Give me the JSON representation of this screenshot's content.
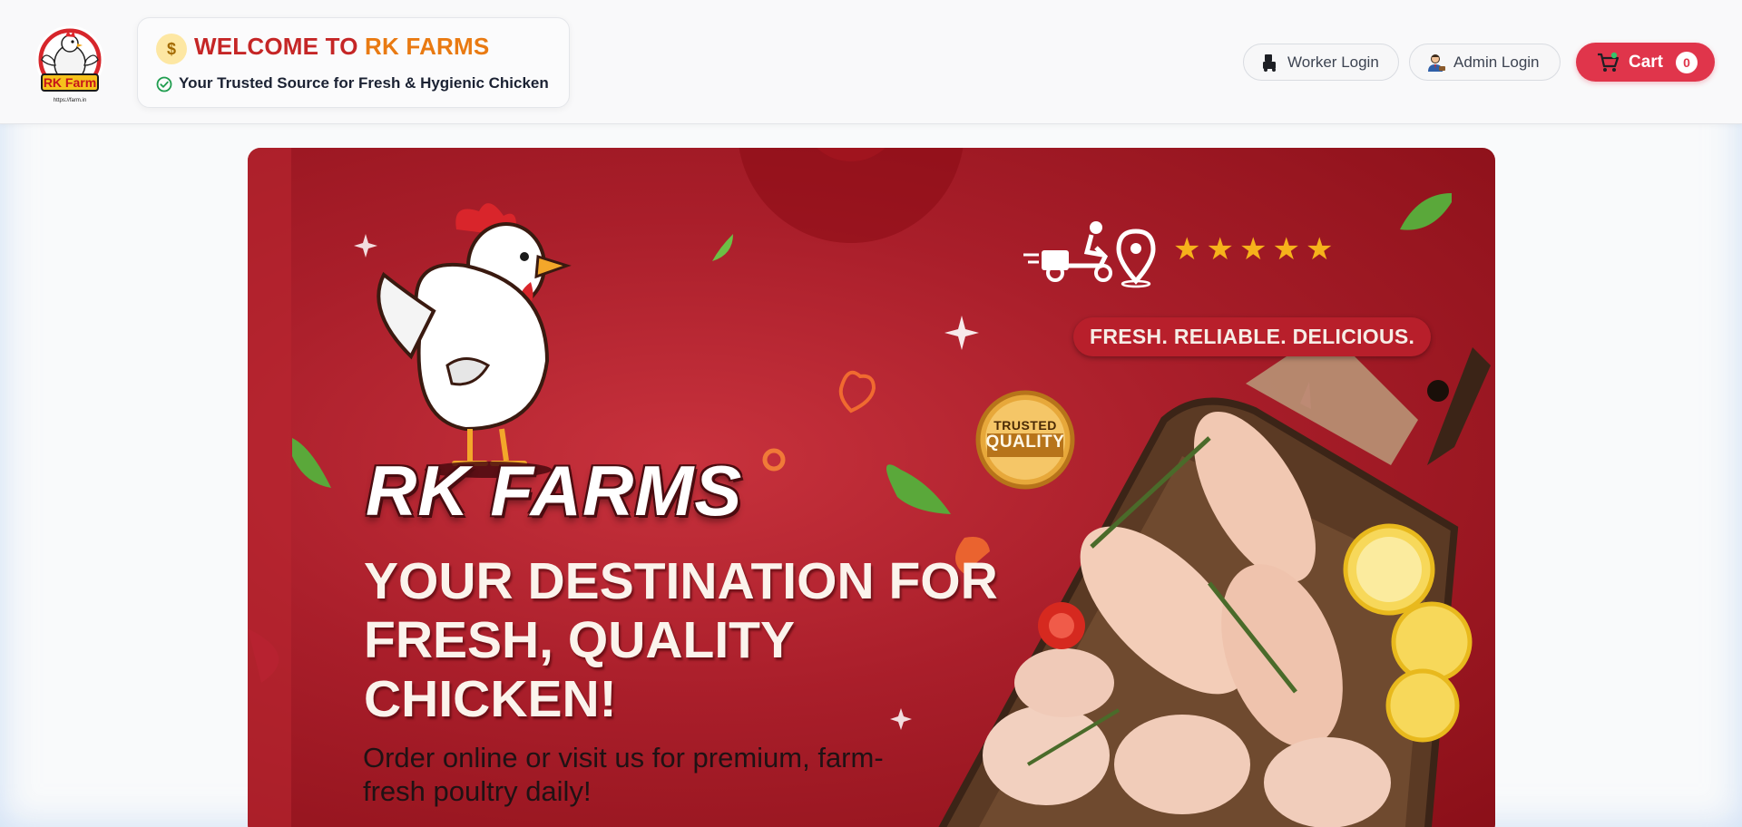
{
  "header": {
    "logo": {
      "icon": "rk-farm-chicken-logo",
      "text": "RK Farm"
    },
    "welcome": {
      "icon": "dollar-coin-icon",
      "title_part1": "WELCOME TO ",
      "title_part2": "RK FARMS",
      "tagline_icon": "check-circle-icon",
      "tagline": "Your Trusted Source for Fresh & Hygienic Chicken"
    },
    "worker_login": {
      "label": "Worker Login",
      "icon": "worker-icon"
    },
    "admin_login": {
      "label": "Admin Login",
      "icon": "admin-user-icon"
    },
    "cart": {
      "label": "Cart",
      "count": "0",
      "icon": "shopping-cart-icon"
    }
  },
  "hero": {
    "brand": "RK FARMS",
    "headline": "YOUR DESTINATION FOR FRESH, QUALITY CHICKEN!",
    "subheadline": "Order online or visit us for premium, farm-fresh poultry daily!",
    "tagline": "FRESH. RELIABLE. DELICIOUS.",
    "badge_line1": "TRUSTED",
    "badge_line2": "QUALITY",
    "rating_stars": 5,
    "icons": [
      "delivery-scooter-icon",
      "location-pin-icon",
      "star-icon"
    ]
  },
  "colors": {
    "brand_red": "#c52626",
    "brand_orange": "#e97a12",
    "cart_red": "#e0354b",
    "hero_red": "#a91e2a",
    "star_gold": "#f6b21b"
  }
}
